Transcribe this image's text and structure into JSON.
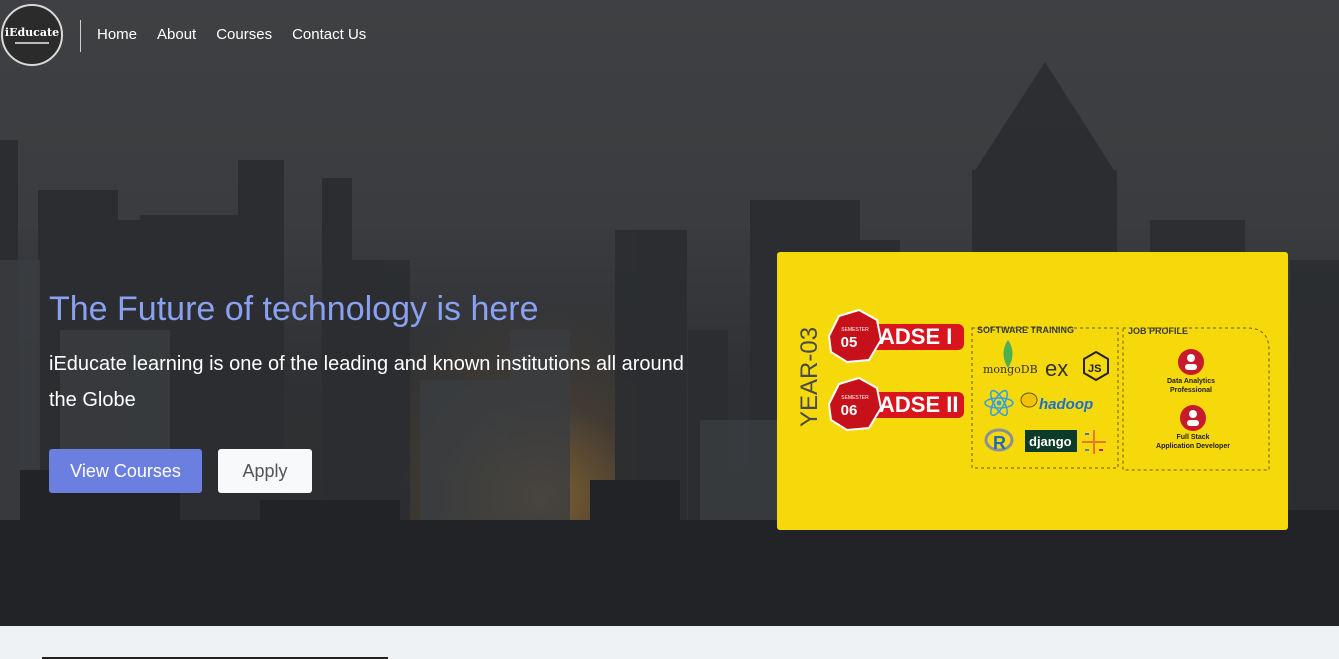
{
  "brand": {
    "logo_text": "iEducate"
  },
  "nav": {
    "items": [
      "Home",
      "About",
      "Courses",
      "Contact Us"
    ]
  },
  "hero": {
    "title": "The Future of technology is here",
    "subtitle": "iEducate learning is one of the leading and known institutions all around the Globe",
    "buttons": {
      "primary": "View Courses",
      "secondary": "Apply"
    },
    "colors": {
      "title": "#8aa1f2",
      "primary_button": "#6b7fe0",
      "banner_bg": "#f5d90a"
    }
  },
  "banner": {
    "year": "YEAR-03",
    "semesters": [
      {
        "label": "SEMESTER",
        "number": "05",
        "course": "ADSE I"
      },
      {
        "label": "SEMESTER",
        "number": "06",
        "course": "ADSE II"
      }
    ],
    "software_training": {
      "title": "SOFTWARE TRAINING",
      "items": [
        "mongoDB",
        "ex",
        "JS",
        "hadoop",
        "R",
        "django"
      ]
    },
    "job_profile": {
      "title": "JOB PROFILE",
      "roles": [
        {
          "line1": "Data Analytics",
          "line2": "Professional"
        },
        {
          "line1": "Full Stack",
          "line2": "Application Developer"
        }
      ]
    }
  }
}
